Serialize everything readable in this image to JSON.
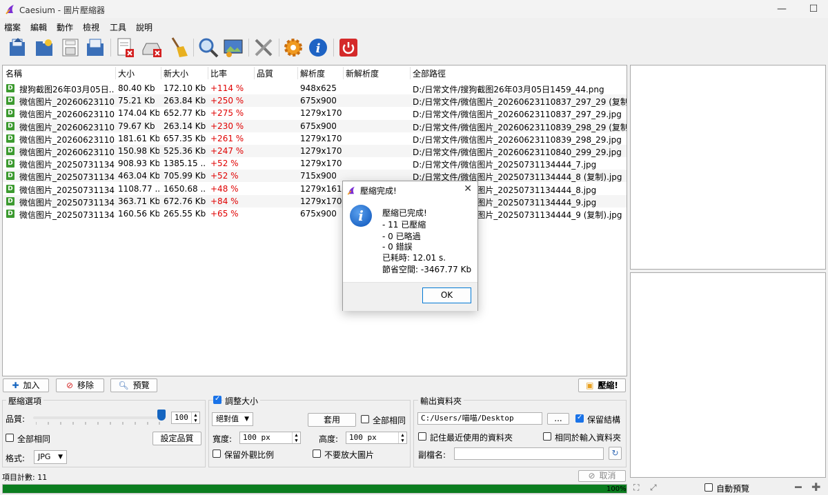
{
  "window": {
    "title": "Caesium - 圖片壓縮器",
    "controls": {
      "minimize": "—",
      "maximize": "☐",
      "close": "✕"
    }
  },
  "menu": [
    "檔案",
    "編輯",
    "動作",
    "檢視",
    "工具",
    "說明"
  ],
  "toolbar": {
    "icons": [
      "open-file-icon",
      "open-folder-icon",
      "save-icon",
      "save-as-icon",
      "remove-item-icon",
      "clear-list-icon",
      "clean-broom-icon",
      "search-icon",
      "preview-image-icon",
      "settings-tools-icon",
      "gear-icon",
      "info-icon",
      "power-icon"
    ]
  },
  "filelist": {
    "columns": [
      "名稱",
      "大小",
      "新大小",
      "比率",
      "品質",
      "解析度",
      "新解析度",
      "全部路徑"
    ],
    "badge": "D",
    "rows": [
      {
        "name": "搜狗截图26年03月05日...",
        "size": "80.40 Kb",
        "new_size": "172.10 Kb",
        "ratio": "+114 %",
        "quality": "",
        "res": "948x625",
        "new_res": "",
        "path": "D:/日常文件/搜狗截图26年03月05日1459_44.png"
      },
      {
        "name": "微信图片_20260623110...",
        "size": "75.21 Kb",
        "new_size": "263.84 Kb",
        "ratio": "+250 %",
        "quality": "",
        "res": "675x900",
        "new_res": "",
        "path": "D:/日常文件/微信图片_20260623110837_297_29 (复制).j..."
      },
      {
        "name": "微信图片_20260623110...",
        "size": "174.04 Kb",
        "new_size": "652.77 Kb",
        "ratio": "+275 %",
        "quality": "",
        "res": "1279x1706",
        "new_res": "",
        "path": "D:/日常文件/微信图片_20260623110837_297_29.jpg"
      },
      {
        "name": "微信图片_20260623110...",
        "size": "79.67 Kb",
        "new_size": "263.14 Kb",
        "ratio": "+230 %",
        "quality": "",
        "res": "675x900",
        "new_res": "",
        "path": "D:/日常文件/微信图片_20260623110839_298_29 (复制).j..."
      },
      {
        "name": "微信图片_20260623110...",
        "size": "181.61 Kb",
        "new_size": "657.35 Kb",
        "ratio": "+261 %",
        "quality": "",
        "res": "1279x1706",
        "new_res": "",
        "path": "D:/日常文件/微信图片_20260623110839_298_29.jpg"
      },
      {
        "name": "微信图片_20260623110...",
        "size": "150.98 Kb",
        "new_size": "525.36 Kb",
        "ratio": "+247 %",
        "quality": "",
        "res": "1279x1706",
        "new_res": "",
        "path": "D:/日常文件/微信图片_20260623110840_299_29.jpg"
      },
      {
        "name": "微信图片_20250731134...",
        "size": "908.93 Kb",
        "new_size": "1385.15 ...",
        "ratio": "+52 %",
        "quality": "",
        "res": "1279x1706",
        "new_res": "",
        "path": "D:/日常文件/微信图片_20250731134444_7.jpg"
      },
      {
        "name": "微信图片_20250731134...",
        "size": "463.04 Kb",
        "new_size": "705.99 Kb",
        "ratio": "+52 %",
        "quality": "",
        "res": "715x900",
        "new_res": "",
        "path": "D:/日常文件/微信图片_20250731134444_8 (复制).jpg"
      },
      {
        "name": "微信图片_20250731134...",
        "size": "1108.77 ...",
        "new_size": "1650.68 ...",
        "ratio": "+48 %",
        "quality": "",
        "res": "1279x1611",
        "new_res": "",
        "path": "D:/日常文件/微信图片_20250731134444_8.jpg"
      },
      {
        "name": "微信图片_20250731134...",
        "size": "363.71 Kb",
        "new_size": "672.76 Kb",
        "ratio": "+84 %",
        "quality": "",
        "res": "1279x1706",
        "new_res": "",
        "path": "D:/日常文件/微信图片_20250731134444_9.jpg"
      },
      {
        "name": "微信图片_20250731134...",
        "size": "160.56 Kb",
        "new_size": "265.55 Kb",
        "ratio": "+65 %",
        "quality": "",
        "res": "675x900",
        "new_res": "",
        "path": "D:/日常文件/微信图片_20250731134444_9 (复制).jpg"
      }
    ]
  },
  "actions": {
    "add": "加入",
    "remove": "移除",
    "preview": "預覽",
    "compress": "壓縮!"
  },
  "compress_options": {
    "title": "壓縮選項",
    "quality_label": "品質:",
    "quality_value": "100",
    "quality_fraction": 1.0,
    "same_for_all": "全部相同",
    "set_quality": "設定品質",
    "format_label": "格式:",
    "format_value": "JPG"
  },
  "resize": {
    "title": "調整大小",
    "checked": true,
    "mode": "絕對值",
    "apply": "套用",
    "same_for_all": "全部相同",
    "width_label": "寬度:",
    "width_value": "100 px",
    "height_label": "高度:",
    "height_value": "100 px",
    "keep_ratio": "保留外觀比例",
    "no_enlarge": "不要放大圖片"
  },
  "output": {
    "title": "輸出資料夾",
    "path": "C:/Users/喵喵/Desktop",
    "browse": "...",
    "keep_structure": "保留結構",
    "remember_last": "記住最近使用的資料夾",
    "same_as_input": "相同於輸入資料夾",
    "suffix_label": "副檔名:",
    "suffix_value": ""
  },
  "status": {
    "item_count": "項目計數:  11",
    "cancel": "取消",
    "progress_text": "100%",
    "progress_fraction": 1.0,
    "auto_preview": "自動預覽"
  },
  "dialog": {
    "title": "壓縮完成!",
    "lines": [
      "壓縮已完成!",
      "- 11 已壓縮",
      "- 0 已略過",
      "- 0 錯誤",
      "已耗時:  12.01 s.",
      "節省空間:  -3467.77 Kb"
    ],
    "ok": "OK"
  },
  "colors": {
    "ratio": "#e00000",
    "progress": "#0b7d1f",
    "accent": "#1565c0"
  }
}
